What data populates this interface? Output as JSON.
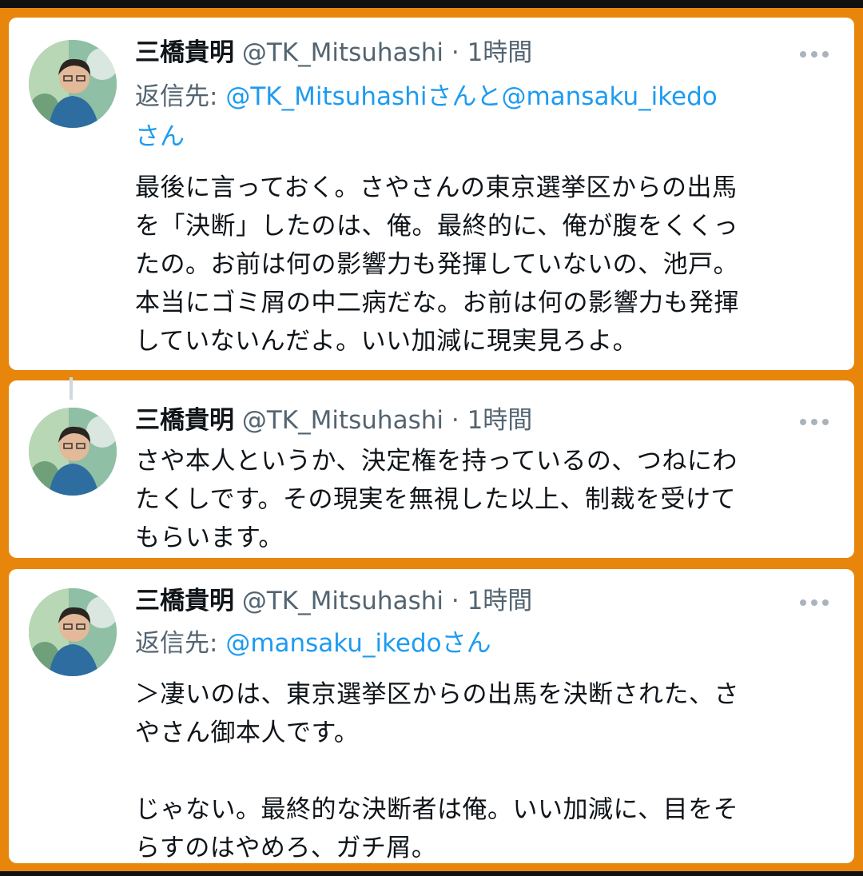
{
  "tweets": [
    {
      "name": "三橋貴明",
      "handle": "@TK_Mitsuhashi",
      "separator": "·",
      "time": "1時間",
      "reply_prefix": "返信先: ",
      "reply_mention_1": "@TK_Mitsuhashi",
      "reply_joiner": "さんと",
      "reply_mention_2": "@mansaku_ikedo",
      "reply_suffix": "さん",
      "lines": [
        "最後に言っておく。さやさんの東京選挙区からの出馬",
        "を「決断」したのは、俺。最終的に、俺が腹をくくっ",
        "たの。お前は何の影響力も発揮していないの、池戸。",
        "本当にゴミ屑の中二病だな。お前は何の影響力も発揮",
        "していないんだよ。いい加減に現実見ろよ。"
      ]
    },
    {
      "name": "三橋貴明",
      "handle": "@TK_Mitsuhashi",
      "separator": "·",
      "time": "1時間",
      "lines": [
        "さや本人というか、決定権を持っているの、つねにわ",
        "たくしです。その現実を無視した以上、制裁を受けて",
        "もらいます。"
      ]
    },
    {
      "name": "三橋貴明",
      "handle": "@TK_Mitsuhashi",
      "separator": "·",
      "time": "1時間",
      "reply_prefix": "返信先: ",
      "reply_mention_1": "@mansaku_ikedo",
      "reply_suffix": "さん",
      "lines": [
        "＞凄いのは、東京選挙区からの出馬を決断された、さ",
        "やさん御本人です。",
        "",
        "じゃない。最終的な決断者は俺。いい加減に、目をそ",
        "らすのはやめろ、ガチ屑。"
      ]
    }
  ],
  "colors": {
    "frame": "#e8860c",
    "text": "#0f1419",
    "secondary": "#536471",
    "link": "#1d9bf0"
  },
  "icons": [
    "avatar",
    "more-options-icon"
  ]
}
